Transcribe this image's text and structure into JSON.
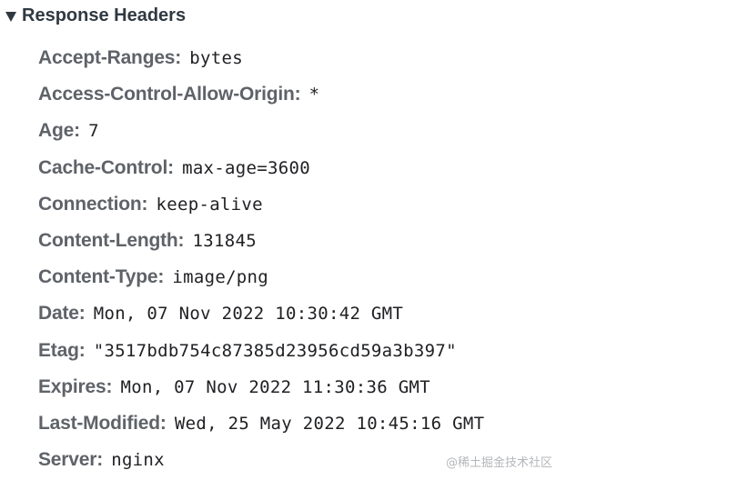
{
  "section": {
    "title": "Response Headers",
    "expanded": true,
    "toggle_icon": "triangle-down-icon"
  },
  "headers": [
    {
      "name": "Accept-Ranges",
      "value": "bytes"
    },
    {
      "name": "Access-Control-Allow-Origin",
      "value": "*"
    },
    {
      "name": "Age",
      "value": "7"
    },
    {
      "name": "Cache-Control",
      "value": "max-age=3600"
    },
    {
      "name": "Connection",
      "value": "keep-alive"
    },
    {
      "name": "Content-Length",
      "value": "131845"
    },
    {
      "name": "Content-Type",
      "value": "image/png"
    },
    {
      "name": "Date",
      "value": "Mon, 07 Nov 2022 10:30:42 GMT"
    },
    {
      "name": "Etag",
      "value": "\"3517bdb754c87385d23956cd59a3b397\""
    },
    {
      "name": "Expires",
      "value": "Mon, 07 Nov 2022 11:30:36 GMT"
    },
    {
      "name": "Last-Modified",
      "value": "Wed, 25 May 2022 10:45:16 GMT"
    },
    {
      "name": "Server",
      "value": "nginx"
    }
  ],
  "separator": ":",
  "watermark": "@稀土掘金技术社区"
}
